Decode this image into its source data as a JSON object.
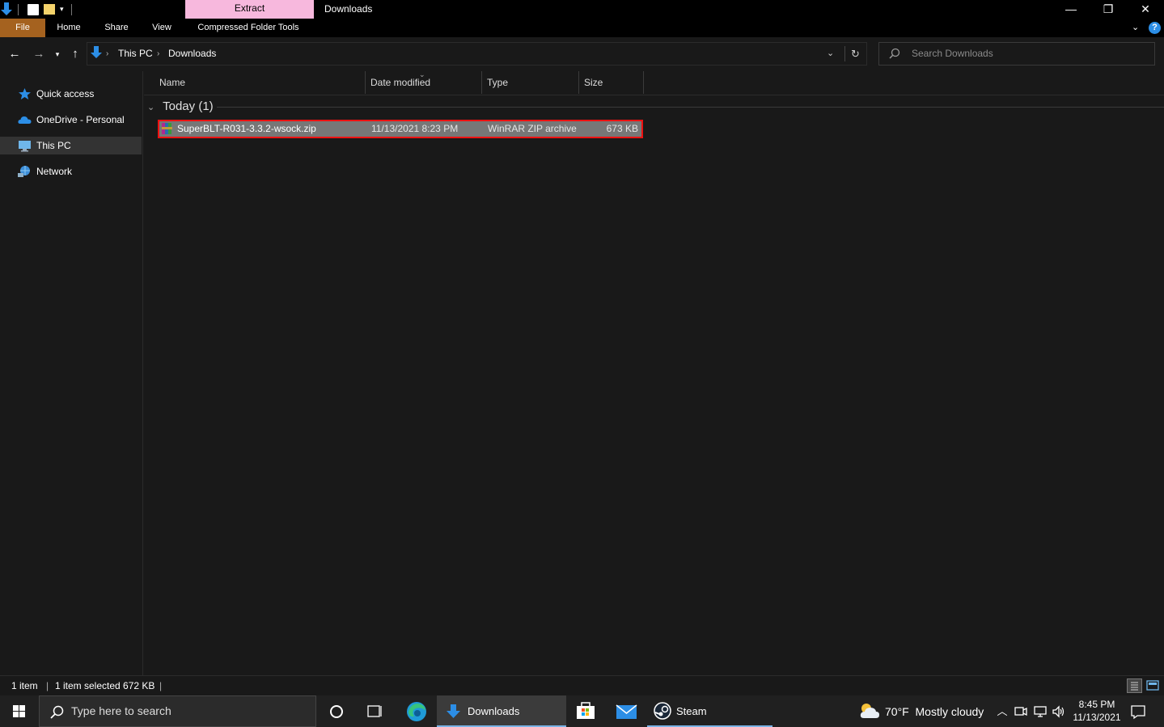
{
  "window": {
    "title": "Downloads",
    "context_tab": "Extract",
    "controls": {
      "minimize": "—",
      "maximize": "❐",
      "close": "✕"
    }
  },
  "ribbon": {
    "tabs": [
      "File",
      "Home",
      "Share",
      "View",
      "Compressed Folder Tools"
    ],
    "help": "?"
  },
  "address": {
    "segments": [
      "This PC",
      "Downloads"
    ],
    "search_placeholder": "Search Downloads"
  },
  "navpane": {
    "items": [
      {
        "label": "Quick access",
        "icon": "star-icon"
      },
      {
        "label": "OneDrive - Personal",
        "icon": "cloud-icon"
      },
      {
        "label": "This PC",
        "icon": "pc-icon",
        "selected": true
      },
      {
        "label": "Network",
        "icon": "network-icon"
      }
    ]
  },
  "content": {
    "columns": [
      "Name",
      "Date modified",
      "Type",
      "Size"
    ],
    "group": "Today (1)",
    "files": [
      {
        "name": "SuperBLT-R031-3.3.2-wsock.zip",
        "date": "11/13/2021 8:23 PM",
        "type": "WinRAR ZIP archive",
        "size": "673 KB"
      }
    ]
  },
  "status": {
    "count": "1 item",
    "selected": "1 item selected  672 KB"
  },
  "taskbar": {
    "search_placeholder": "Type here to search",
    "downloads_label": "Downloads",
    "steam_label": "Steam",
    "weather": "70°F  Mostly cloudy",
    "time": "8:45 PM",
    "date": "11/13/2021"
  },
  "colors": {
    "extract_tab": "#f7b8dd",
    "file_tab": "#a5621f",
    "selection_border": "#e11111",
    "accent": "#7ab3e6"
  }
}
